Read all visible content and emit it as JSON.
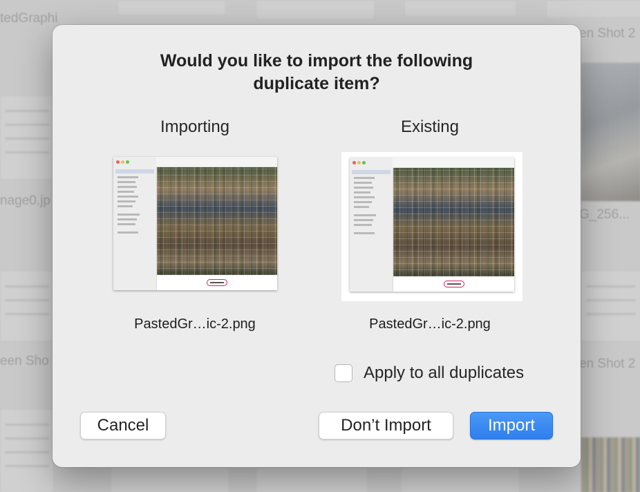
{
  "background": {
    "labels": [
      "tedGraphi",
      "nage0.jp",
      "een Sho",
      "en Shot 2",
      "G_256...",
      "en Shot 2"
    ]
  },
  "dialog": {
    "title_line1": "Would you like to import the following",
    "title_line2": "duplicate item?",
    "importing": {
      "heading": "Importing",
      "filename": "PastedGr…ic-2.png"
    },
    "existing": {
      "heading": "Existing",
      "filename": "PastedGr…ic-2.png"
    },
    "apply_all": {
      "label": "Apply to all duplicates",
      "checked": false
    },
    "buttons": {
      "cancel": "Cancel",
      "dont_import": "Don’t Import",
      "import": "Import"
    }
  },
  "colors": {
    "primary_button": "#2f7fee",
    "dialog_bg": "#ececec",
    "highlight_pill": "#d3235b"
  }
}
